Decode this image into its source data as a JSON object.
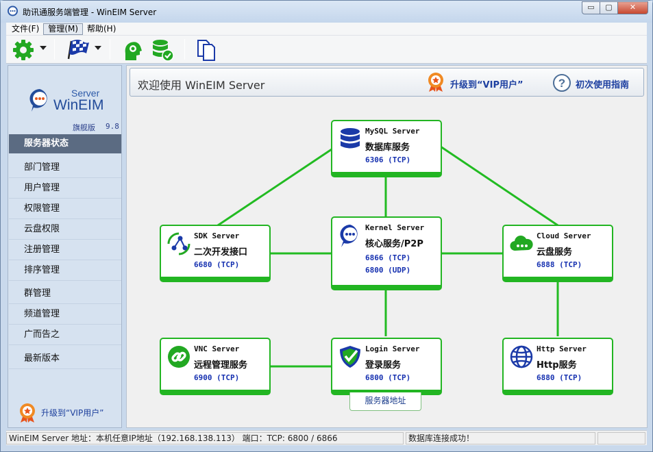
{
  "window": {
    "title": "助讯通服务端管理 - WinEIM Server",
    "controls": {
      "minimize": "▭",
      "maximize": "▢",
      "close": "✕"
    }
  },
  "menubar": {
    "items": [
      "文件(F)",
      "管理(M)",
      "帮助(H)"
    ],
    "active_index": 1
  },
  "toolbar": {
    "icons": [
      "settings-gear-icon",
      "checkered-flag-icon",
      "user-settings-icon",
      "database-check-icon",
      "copy-documents-icon"
    ],
    "accent_green": "#22b522",
    "accent_blue": "#1c3f9c"
  },
  "sidebar": {
    "logo_server": "Server",
    "logo_name": "WinEIM",
    "edition": "旗舰版",
    "version": "9.8",
    "selected": "服务器状态",
    "groups": [
      [
        "部门管理",
        "用户管理",
        "权限管理",
        "云盘权限",
        "注册管理",
        "排序管理"
      ],
      [
        "群管理",
        "频道管理",
        "广而告之"
      ],
      [
        "最新版本"
      ]
    ],
    "vip_text": "升级到“VIP用户”"
  },
  "main": {
    "welcome": "欢迎使用 WinEIM Server",
    "vip_link": "升级到“VIP用户”",
    "guide_link": "初次使用指南",
    "address_button": "服务器地址"
  },
  "servers": {
    "mysql": {
      "title": "MySQL Server",
      "sub": "数据库服务",
      "port1": "6306 (TCP)",
      "icon": "database-icon"
    },
    "sdk": {
      "title": "SDK Server",
      "sub": "二次开发接口",
      "port1": "6680 (TCP)",
      "icon": "share-nodes-icon"
    },
    "kernel": {
      "title": "Kernel Server",
      "sub": "核心服务/P2P",
      "port1": "6866 (TCP)",
      "port2": "6800 (UDP)",
      "icon": "chat-bubble-icon"
    },
    "cloud": {
      "title": "Cloud Server",
      "sub": "云盘服务",
      "port1": "6888 (TCP)",
      "icon": "cloud-icon"
    },
    "vnc": {
      "title": "VNC Server",
      "sub": "远程管理服务",
      "port1": "6900 (TCP)",
      "icon": "link-icon"
    },
    "login": {
      "title": "Login Server",
      "sub": "登录服务",
      "port1": "6800 (TCP)",
      "icon": "shield-check-icon"
    },
    "http": {
      "title": "Http Server",
      "sub": "Http服务",
      "port1": "6880 (TCP)",
      "icon": "globe-icon"
    }
  },
  "statusbar": {
    "address": "WinEIM Server 地址：本机任意IP地址（192.168.138.113）  端口：TCP: 6800 / 6866",
    "db_status": "数据库连接成功！"
  }
}
